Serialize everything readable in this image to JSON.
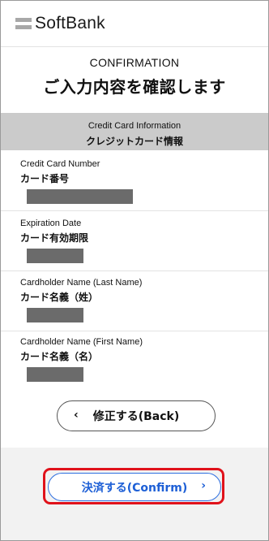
{
  "header": {
    "logo_text": "SoftBank"
  },
  "title": {
    "en": "CONFIRMATION",
    "ja": "ご入力内容を確認します"
  },
  "section": {
    "en": "Credit Card Information",
    "ja": "クレジットカード情報"
  },
  "fields": [
    {
      "label_en": "Credit Card Number",
      "label_ja": "カード番号",
      "value": ""
    },
    {
      "label_en": "Expiration Date",
      "label_ja": "カード有効期限",
      "value": ""
    },
    {
      "label_en": "Cardholder Name (Last Name)",
      "label_ja": "カード名義（姓）",
      "value": ""
    },
    {
      "label_en": "Cardholder Name (First Name)",
      "label_ja": "カード名義（名）",
      "value": ""
    }
  ],
  "buttons": {
    "back_label": "修正する(Back)",
    "back_chevron": "‹",
    "confirm_label": "決済する(Confirm)",
    "confirm_chevron": "›"
  },
  "colors": {
    "confirm_accent": "#1d5fd6",
    "highlight": "#e0121b",
    "section_bg": "#cbcbcb",
    "mask": "#6b6b6b"
  }
}
